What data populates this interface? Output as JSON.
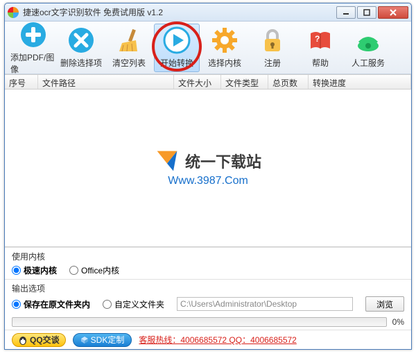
{
  "window": {
    "title": "捷速ocr文字识别软件 免费试用版 v1.2"
  },
  "toolbar": {
    "add": "添加PDF/图像",
    "remove": "删除选择项",
    "clear": "清空列表",
    "start": "开始转换",
    "kernel": "选择内核",
    "register": "注册",
    "help": "帮助",
    "service": "人工服务"
  },
  "columns": {
    "index": "序号",
    "path": "文件路径",
    "size": "文件大小",
    "type": "文件类型",
    "pages": "总页数",
    "progress": "转换进度"
  },
  "watermark": {
    "title": "统一下载站",
    "url": "Www.3987.Com"
  },
  "kernel_panel": {
    "title": "使用内核",
    "fast": "极速内核",
    "office": "Office内核"
  },
  "output_panel": {
    "title": "输出选项",
    "same_folder": "保存在原文件夹内",
    "custom_folder": "自定义文件夹",
    "path": "C:\\Users\\Administrator\\Desktop",
    "browse": "浏览"
  },
  "progress": {
    "pct": "0%"
  },
  "bottom": {
    "qq": "QQ交谈",
    "sdk": "SDK定制",
    "hotline": "客服热线：4006685572 QQ：4006685572"
  }
}
